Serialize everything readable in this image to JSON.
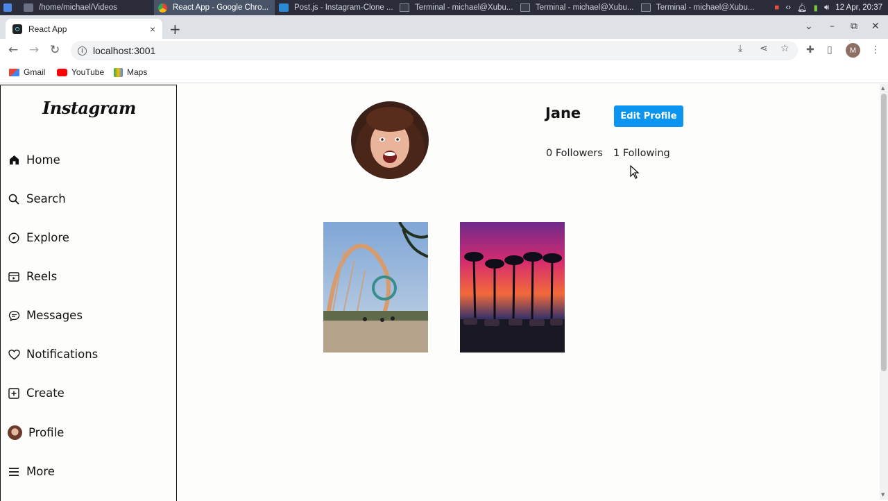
{
  "taskbar": {
    "tasks": [
      {
        "label": "/home/michael/Videos",
        "icon": "folder-icon"
      },
      {
        "label": "React App - Google Chro...",
        "icon": "chrome-icon"
      },
      {
        "label": "Post.js - Instagram-Clone ...",
        "icon": "vscode-icon"
      },
      {
        "label": "Terminal - michael@Xubu...",
        "icon": "terminal-icon"
      },
      {
        "label": "Terminal - michael@Xubu...",
        "icon": "terminal-icon"
      },
      {
        "label": "Terminal - michael@Xubu...",
        "icon": "terminal-icon"
      }
    ],
    "clock": "12 Apr, 20:37"
  },
  "browser": {
    "tab_title": "React App",
    "tab_close": "×",
    "new_tab": "+",
    "url": "localhost:3001",
    "profile_initial": "M",
    "bookmarks": [
      "Gmail",
      "YouTube",
      "Maps"
    ]
  },
  "sidebar": {
    "logo": "Instagram",
    "items": [
      {
        "label": "Home",
        "icon": "home-icon"
      },
      {
        "label": "Search",
        "icon": "search-icon"
      },
      {
        "label": "Explore",
        "icon": "compass-icon"
      },
      {
        "label": "Reels",
        "icon": "reels-icon"
      },
      {
        "label": "Messages",
        "icon": "messages-icon"
      },
      {
        "label": "Notifications",
        "icon": "heart-icon"
      },
      {
        "label": "Create",
        "icon": "plus-square-icon"
      },
      {
        "label": "Profile",
        "icon": "profile-avatar"
      },
      {
        "label": "More",
        "icon": "menu-icon"
      }
    ]
  },
  "profile": {
    "username": "Jane",
    "edit_button": "Edit Profile",
    "followers": "0 Followers",
    "following": "1 Following"
  },
  "colors": {
    "accent": "#0b95f0",
    "taskbar": "#2b2d3a",
    "tabbar": "#dee1e6"
  }
}
